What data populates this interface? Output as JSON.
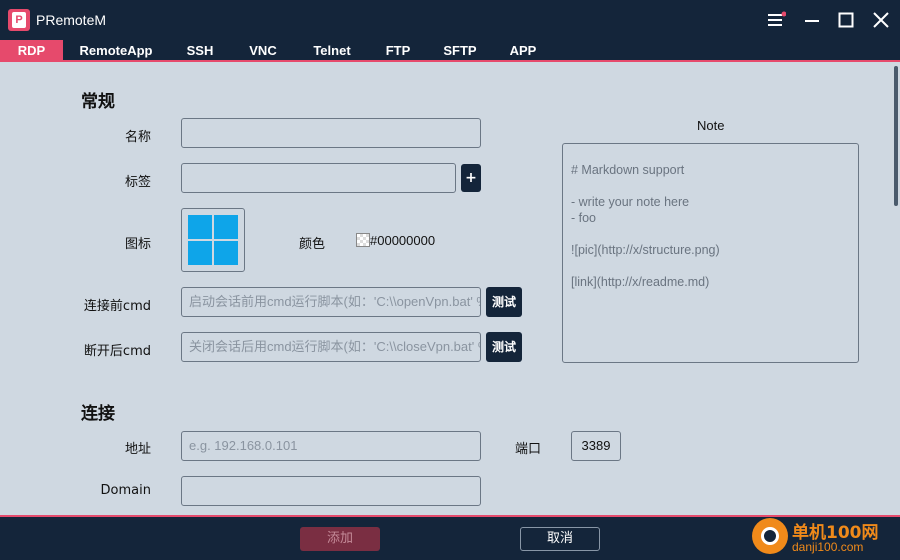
{
  "window": {
    "title": "PRemoteM",
    "logo_letter": "P"
  },
  "tabs": [
    {
      "label": "RDP",
      "active": true
    },
    {
      "label": "RemoteApp"
    },
    {
      "label": "SSH"
    },
    {
      "label": "VNC"
    },
    {
      "label": "Telnet"
    },
    {
      "label": "FTP"
    },
    {
      "label": "SFTP"
    },
    {
      "label": "APP"
    }
  ],
  "general": {
    "title": "常规",
    "name_label": "名称",
    "name_value": "",
    "tag_label": "标签",
    "tag_value": "",
    "add_tag_label": "+",
    "icon_label": "图标",
    "color_label": "颜色",
    "color_value": "#00000000",
    "pre_cmd_label": "连接前cmd",
    "pre_cmd_placeholder": "启动会话前用cmd运行脚本(如：'C:\\\\openVpn.bat' %",
    "post_cmd_label": "断开后cmd",
    "post_cmd_placeholder": "关闭会话后用cmd运行脚本(如：'C:\\\\closeVpn.bat' %",
    "test_label": "测试"
  },
  "note": {
    "title": "Note",
    "lines": [
      "# Markdown support",
      "",
      "- write your note here",
      "- foo",
      "",
      "![pic](http://x/structure.png)",
      "",
      "[link](http://x/readme.md)"
    ]
  },
  "connection": {
    "title": "连接",
    "address_label": "地址",
    "address_placeholder": "e.g. 192.168.0.101",
    "port_label": "端口",
    "port_value": "3389",
    "domain_label": "Domain",
    "domain_value": ""
  },
  "footer": {
    "add_label": "添加",
    "cancel_label": "取消"
  },
  "watermark": {
    "line1": "单机100网",
    "line2": "danji100.com"
  },
  "colors": {
    "accent": "#e64a6c",
    "titlebar": "#14253a",
    "background": "#cfd8e1",
    "windows_blue": "#0ea5e9"
  }
}
